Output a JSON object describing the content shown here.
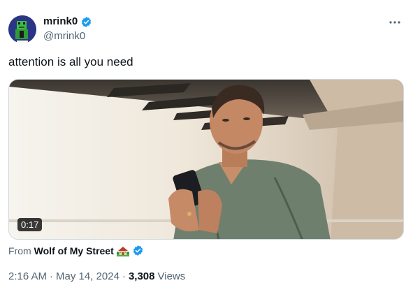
{
  "author": {
    "display_name": "mrink0",
    "handle": "@mrink0",
    "verified": true,
    "verified_color": "#1d9bf0"
  },
  "tweet": {
    "text": "attention is all you need",
    "video_duration": "0:17"
  },
  "source": {
    "prefix": "From",
    "name": "Wolf of My Street",
    "emoji": "house-with-garden-icon",
    "verified": true
  },
  "meta": {
    "time": "2:16 AM",
    "separator": "·",
    "date": "May 14, 2024",
    "views_count": "3,308",
    "views_label": "Views"
  },
  "icons": {
    "more": "more-horizontal-icon",
    "verified": "verified-badge-icon"
  }
}
